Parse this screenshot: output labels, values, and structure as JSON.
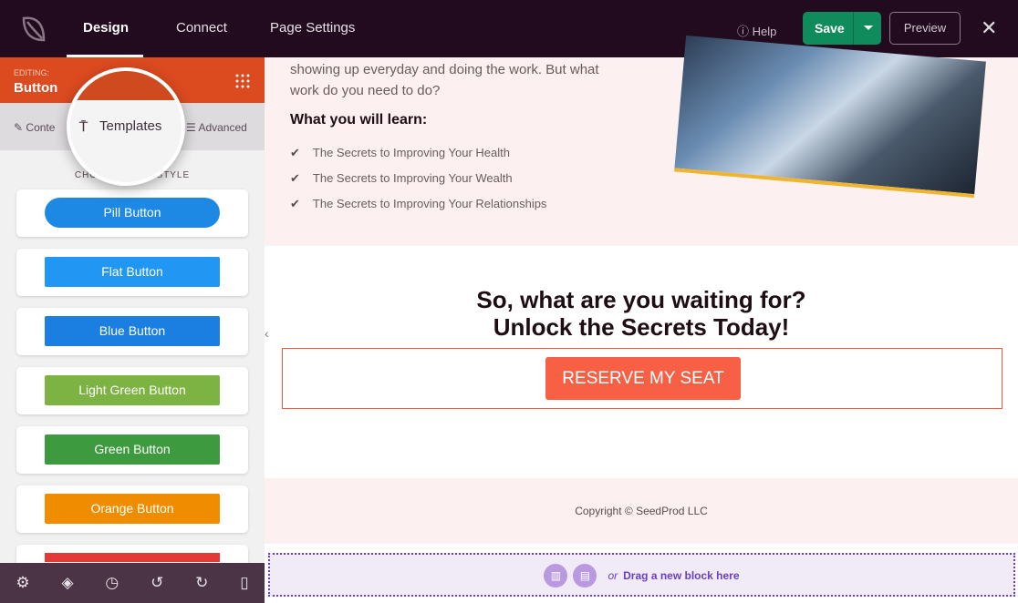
{
  "topbar": {
    "tabs": [
      "Design",
      "Connect",
      "Page Settings"
    ],
    "help": "Help",
    "save": "Save",
    "preview": "Preview",
    "close": "✕"
  },
  "sidebar": {
    "editing_label": "EDITING:",
    "editing_value": "Button",
    "tabs": {
      "content": "Conte",
      "templates": "Templates",
      "advanced": "Advanced"
    },
    "section_title": "CHOOSE YOUR STYLE",
    "templates": [
      {
        "label": "Pill Button",
        "color": "#1e88e5"
      },
      {
        "label": "Flat Button",
        "color": "#2196f3"
      },
      {
        "label": "Blue Button",
        "color": "#1a7fe0"
      },
      {
        "label": "Light Green Button",
        "color": "#7cb342"
      },
      {
        "label": "Green Button",
        "color": "#3d9a3e"
      },
      {
        "label": "Orange Button",
        "color": "#f08c00"
      }
    ],
    "toolbar": [
      "settings-icon",
      "layers-icon",
      "history-icon",
      "undo-icon",
      "redo-icon",
      "mobile-preview-icon"
    ]
  },
  "canvas": {
    "intro": "showing up everyday and doing the work. But what work do you need to do?",
    "learn_heading": "What you will learn:",
    "learn_items": [
      "The Secrets to Improving Your Health",
      "The Secrets to Improving Your Wealth",
      "The Secrets to Improving Your Relationships"
    ],
    "cta_line1": "So, what are you waiting for?",
    "cta_line2": "Unlock the Secrets Today!",
    "cta_button": "RESERVE MY SEAT",
    "copyright": "Copyright © SeedProd LLC",
    "drag_or": "or",
    "drag_text": "Drag a new block here"
  }
}
